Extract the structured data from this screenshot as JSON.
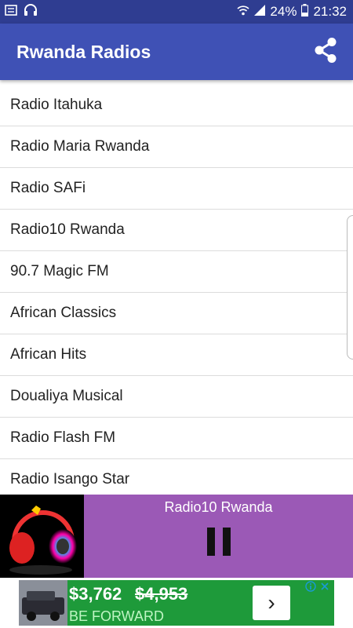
{
  "status_bar": {
    "battery": "24%",
    "time": "21:32"
  },
  "app_bar": {
    "title": "Rwanda Radios",
    "share_icon": "share-icon"
  },
  "stations": [
    "Radio Itahuka",
    "Radio Maria Rwanda",
    "Radio SAFi",
    "Radio10 Rwanda",
    "90.7 Magic FM",
    "African Classics",
    "African Hits",
    "Doualiya Musical",
    "Radio Flash FM",
    "Radio Isango Star"
  ],
  "player": {
    "now_playing": "Radio10 Rwanda",
    "state_icon": "pause-icon"
  },
  "ad": {
    "price": "$3,762",
    "old_price": "$4,953",
    "brand": "BE FORWARD",
    "arrow": "›"
  },
  "colors": {
    "status_bar": "#2f3d91",
    "app_bar": "#3f51b5",
    "player": "#9b59b6",
    "ad_green": "#1e9a3a"
  }
}
